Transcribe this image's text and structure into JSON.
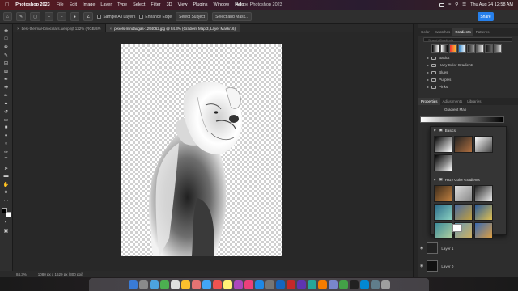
{
  "menubar": {
    "apple": "",
    "app_name": "Photoshop 2023",
    "menus": [
      "File",
      "Edit",
      "Image",
      "Layer",
      "Type",
      "Select",
      "Filter",
      "3D",
      "View",
      "Plugins",
      "Window",
      "Help"
    ],
    "window_title": "Adobe Photoshop 2023",
    "clock": "Thu Aug 24  12:58 AM"
  },
  "options_bar": {
    "sample_all_layers": "Sample All Layers",
    "enhance_edge": "Enhance Edge",
    "select_subject": "Select Subject",
    "select_and_mask": "Select and Mask...",
    "share": "Share"
  },
  "tabs": [
    {
      "label": "best-thermal-binoculars.webp @ 122% (RGB/8#)",
      "active": false
    },
    {
      "label": "pexels-mindaugas-1294062.jpg @ 84.3% (Gradient Map 3, Layer Mask/16)",
      "active": true
    }
  ],
  "status": {
    "zoom": "84.3%",
    "doc_info": "1080 px x 1620 px (300 ppi)"
  },
  "right_panel": {
    "top_tabs": [
      "Color",
      "Swatches",
      "Gradients",
      "Patterns"
    ],
    "top_active": "Gradients",
    "search_placeholder": "Search Gradients",
    "folders": [
      "Basics",
      "Hazy Color Gradients",
      "Blues",
      "Purples",
      "Pinks"
    ],
    "props_tabs": [
      "Properties",
      "Adjustments",
      "Libraries"
    ],
    "props_active": "Properties",
    "props_title": "Gradient Map",
    "dropdown_groups": [
      "Basics",
      "Hazy Color Gradients"
    ],
    "layers": [
      "Layer 1",
      "Layer 0"
    ]
  },
  "colors": {
    "accent": "#2680eb",
    "panel_bg": "#2d2d2d",
    "canvas_bg": "#282828"
  }
}
